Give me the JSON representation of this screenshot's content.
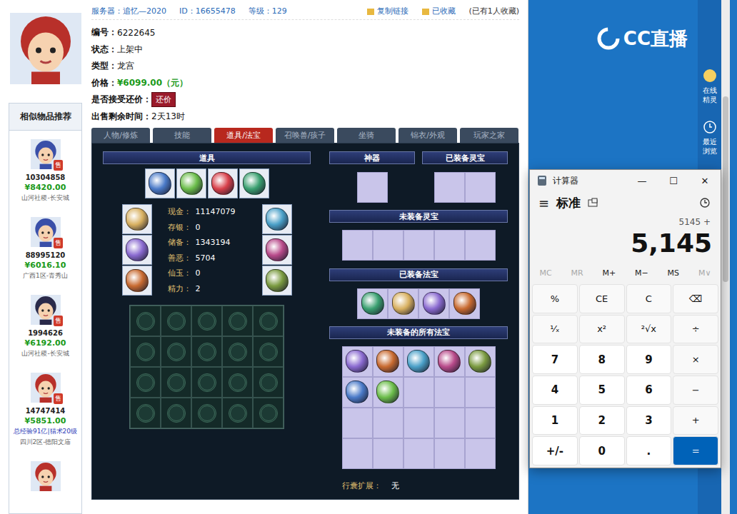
{
  "listing": {
    "header": {
      "server_label": "服务器：",
      "server": "追忆—2020",
      "id_label": "ID：",
      "id": "16655478",
      "level_label": "等级：",
      "level": "129",
      "copy_link": "复制链接",
      "favorite": "已收藏",
      "favorite_count": "(已有1人收藏)"
    },
    "details": [
      {
        "label": "编号：",
        "value": "6222645",
        "kind": "text"
      },
      {
        "label": "状态：",
        "value": "上架中",
        "kind": "text"
      },
      {
        "label": "类型：",
        "value": "龙宫",
        "kind": "text"
      },
      {
        "label": "价格：",
        "value": "¥6099.00（元）",
        "kind": "price"
      },
      {
        "label": "是否接受还价：",
        "value": "还价",
        "kind": "button"
      },
      {
        "label": "出售剩余时间：",
        "value": "2天13时",
        "kind": "text"
      }
    ]
  },
  "sidebar": {
    "title": "相似物品推荐",
    "items": [
      {
        "kind": "full",
        "badge": "售",
        "id": "10304858",
        "price": "¥8420.00",
        "note": "",
        "server": "山河社稷-长安城"
      },
      {
        "kind": "full",
        "badge": "售",
        "id": "88995120",
        "price": "¥6016.10",
        "note": "",
        "server": "广西1区-青秀山"
      },
      {
        "kind": "full",
        "badge": "售",
        "id": "1994626",
        "price": "¥6192.00",
        "note": "",
        "server": "山河社稷-长安城"
      },
      {
        "kind": "full",
        "badge": "售",
        "id": "14747414",
        "price": "¥5851.00",
        "note": "总经验91亿|猎术20级",
        "server": "四川2区-德阳文庙"
      },
      {
        "kind": "cut",
        "badge": "",
        "id": "",
        "price": "",
        "note": "",
        "server": ""
      }
    ]
  },
  "tabs": [
    {
      "label": "人物/修炼",
      "selected": false
    },
    {
      "label": "技能",
      "selected": false
    },
    {
      "label": "道具/法宝",
      "selected": true
    },
    {
      "label": "召唤兽/孩子",
      "selected": false
    },
    {
      "label": "坐骑",
      "selected": false
    },
    {
      "label": "锦衣/外观",
      "selected": false
    },
    {
      "label": "玩家之家",
      "selected": false
    }
  ],
  "inventory": {
    "title": "道具",
    "equipped": [
      {
        "filled": true
      },
      {
        "filled": true
      },
      {
        "filled": true
      },
      {
        "filled": true
      }
    ],
    "left_slots": [
      {
        "filled": true
      },
      {
        "filled": true
      },
      {
        "filled": true
      }
    ],
    "right_slots": [
      {
        "filled": true
      },
      {
        "filled": true
      },
      {
        "filled": true
      }
    ],
    "stats": [
      {
        "label": "现金：",
        "value": "11147079"
      },
      {
        "label": "存银：",
        "value": "0"
      },
      {
        "label": "储备：",
        "value": "1343194"
      },
      {
        "label": "善恶：",
        "value": "5704"
      },
      {
        "label": "仙玉：",
        "value": "0"
      },
      {
        "label": "精力：",
        "value": "2"
      }
    ],
    "bag": [
      {
        "filled": false
      },
      {
        "filled": false
      },
      {
        "filled": false
      },
      {
        "filled": false
      },
      {
        "filled": false
      },
      {
        "filled": false
      },
      {
        "filled": false
      },
      {
        "filled": false
      },
      {
        "filled": false
      },
      {
        "filled": false
      },
      {
        "filled": false
      },
      {
        "filled": false
      },
      {
        "filled": false
      },
      {
        "filled": false
      },
      {
        "filled": false
      },
      {
        "filled": false
      },
      {
        "filled": false
      },
      {
        "filled": false
      },
      {
        "filled": false
      },
      {
        "filled": false
      }
    ]
  },
  "treasures": {
    "artifact": {
      "title": "神器",
      "slots": [
        {
          "filled": false
        }
      ]
    },
    "equipped_lingbao": {
      "title": "已装备灵宝",
      "slots": [
        {
          "filled": false
        },
        {
          "filled": false
        }
      ]
    },
    "unequipped_lingbao": {
      "title": "未装备灵宝",
      "slots": [
        {
          "filled": false
        },
        {
          "filled": false
        },
        {
          "filled": false
        },
        {
          "filled": false
        },
        {
          "filled": false
        }
      ]
    },
    "equipped_fabao": {
      "title": "已装备法宝",
      "slots": [
        {
          "filled": true
        },
        {
          "filled": true
        },
        {
          "filled": true
        },
        {
          "filled": true
        }
      ]
    },
    "unequipped_fabao": {
      "title": "未装备的所有法宝",
      "slots": [
        {
          "filled": true
        },
        {
          "filled": true
        },
        {
          "filled": true
        },
        {
          "filled": true
        },
        {
          "filled": true
        },
        {
          "filled": true
        },
        {
          "filled": true
        },
        {
          "filled": false
        },
        {
          "filled": false
        },
        {
          "filled": false
        },
        {
          "filled": false
        },
        {
          "filled": false
        },
        {
          "filled": false
        },
        {
          "filled": false
        },
        {
          "filled": false
        },
        {
          "filled": false
        },
        {
          "filled": false
        },
        {
          "filled": false
        },
        {
          "filled": false
        },
        {
          "filled": false
        }
      ]
    },
    "bag_extension": {
      "label": "行囊扩展：",
      "value": "无"
    }
  },
  "right_panel": {
    "logo": "CC直播",
    "side_buttons": [
      {
        "label": "在线精灵"
      },
      {
        "label": "最近浏览"
      }
    ]
  },
  "calculator": {
    "title": "计算器",
    "controls": [
      "—",
      "☐",
      "✕"
    ],
    "menu": "≡",
    "mode": "标准",
    "expression": "5145 +",
    "display": "5,145",
    "memory": [
      {
        "label": "MC",
        "disabled": true
      },
      {
        "label": "MR",
        "disabled": true
      },
      {
        "label": "M+",
        "disabled": false
      },
      {
        "label": "M−",
        "disabled": false
      },
      {
        "label": "MS",
        "disabled": false
      },
      {
        "label": "M∨",
        "disabled": true
      }
    ],
    "keys": [
      {
        "label": "%",
        "kind": "fn"
      },
      {
        "label": "CE",
        "kind": "fn"
      },
      {
        "label": "C",
        "kind": "fn"
      },
      {
        "label": "⌫",
        "kind": "fn"
      },
      {
        "label": "¹⁄ₓ",
        "kind": "fn"
      },
      {
        "label": "x²",
        "kind": "fn"
      },
      {
        "label": "²√x",
        "kind": "fn"
      },
      {
        "label": "÷",
        "kind": "fn"
      },
      {
        "label": "7",
        "kind": "digit"
      },
      {
        "label": "8",
        "kind": "digit"
      },
      {
        "label": "9",
        "kind": "digit"
      },
      {
        "label": "×",
        "kind": "fn"
      },
      {
        "label": "4",
        "kind": "digit"
      },
      {
        "label": "5",
        "kind": "digit"
      },
      {
        "label": "6",
        "kind": "digit"
      },
      {
        "label": "−",
        "kind": "fn"
      },
      {
        "label": "1",
        "kind": "digit"
      },
      {
        "label": "2",
        "kind": "digit"
      },
      {
        "label": "3",
        "kind": "digit"
      },
      {
        "label": "+",
        "kind": "fn"
      },
      {
        "label": "+/-",
        "kind": "digit"
      },
      {
        "label": "0",
        "kind": "digit"
      },
      {
        "label": ".",
        "kind": "digit"
      },
      {
        "label": "=",
        "kind": "equals"
      }
    ]
  }
}
